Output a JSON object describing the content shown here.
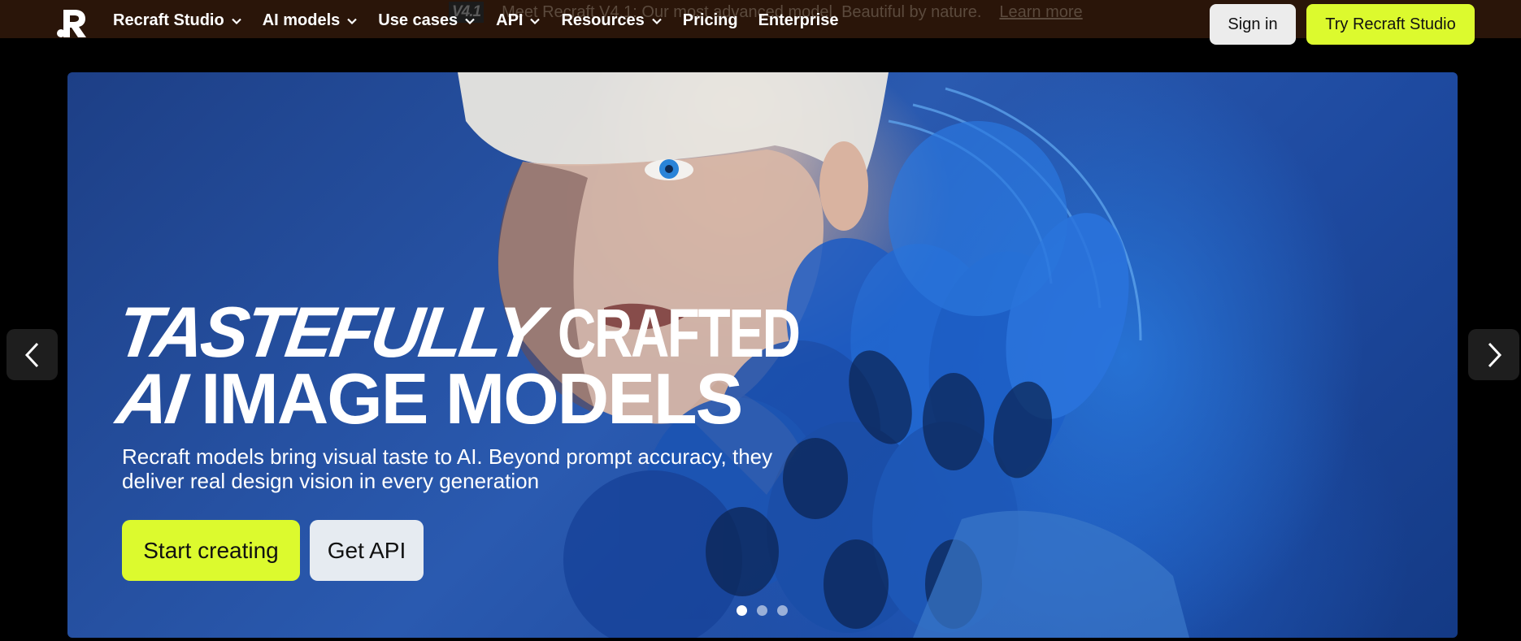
{
  "announcement": {
    "badge": "V4.1",
    "message": "Meet Recraft V4.1: Our most advanced model. Beautiful by nature.",
    "link": "Learn more"
  },
  "nav": {
    "items": [
      {
        "label": "Recraft Studio",
        "dropdown": true
      },
      {
        "label": "AI models",
        "dropdown": true
      },
      {
        "label": "Use cases",
        "dropdown": true
      },
      {
        "label": "API",
        "dropdown": true
      },
      {
        "label": "Resources",
        "dropdown": true
      },
      {
        "label": "Pricing",
        "dropdown": false
      },
      {
        "label": "Enterprise",
        "dropdown": false
      }
    ],
    "sign_in": "Sign in",
    "try": "Try Recraft Studio"
  },
  "hero": {
    "headline_line1_a": "TASTEFULLY",
    "headline_line1_b": "CRAFTED",
    "headline_line2_a": "AI",
    "headline_line2_b": "IMAGE MODELS",
    "subtitle_line1": "Recraft models bring visual taste to AI. Beyond prompt accuracy, they",
    "subtitle_line2": "deliver real design vision in every generation",
    "start_button": "Start creating",
    "api_button": "Get API",
    "slides": 3,
    "active_slide": 1
  },
  "colors": {
    "accent": "#dcfa2e",
    "topbar": "#2a1509"
  }
}
